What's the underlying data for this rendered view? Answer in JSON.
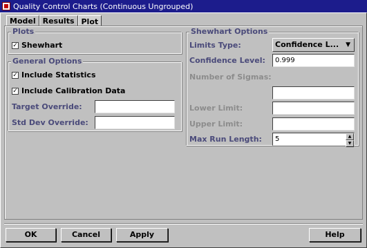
{
  "window": {
    "title": "Quality Control Charts (Continuous Ungrouped)"
  },
  "tabs": [
    {
      "label": "Model"
    },
    {
      "label": "Results"
    },
    {
      "label": "Plot"
    }
  ],
  "plots": {
    "legend": "Plots",
    "shewhart": {
      "label": "Shewhart",
      "checked": true
    }
  },
  "general": {
    "legend": "General Options",
    "include_statistics": {
      "label": "Include Statistics",
      "checked": true
    },
    "include_calibration": {
      "label": "Include Calibration Data",
      "checked": true
    },
    "target_override": {
      "label": "Target Override:",
      "value": ""
    },
    "std_dev_override": {
      "label": "Std Dev Override:",
      "value": ""
    }
  },
  "shewhart_options": {
    "legend": "Shewhart Options",
    "limits_type": {
      "label": "Limits Type:",
      "value": "Confidence L..."
    },
    "confidence_level": {
      "label": "Confidence Level:",
      "value": "0.999"
    },
    "number_of_sigmas": {
      "label": "Number of Sigmas:",
      "value": ""
    },
    "lower_limit": {
      "label": "Lower Limit:",
      "value": ""
    },
    "upper_limit": {
      "label": "Upper Limit:",
      "value": ""
    },
    "max_run_length": {
      "label": "Max Run Length:",
      "value": "5"
    }
  },
  "buttons": {
    "ok": "OK",
    "cancel": "Cancel",
    "apply": "Apply",
    "help": "Help"
  },
  "check_glyph": "✓",
  "colors": {
    "titlebar": "#1c1c8c",
    "label": "#4a4a7a",
    "disabled_label": "#8c8c8c",
    "background": "#c0c0c0"
  }
}
